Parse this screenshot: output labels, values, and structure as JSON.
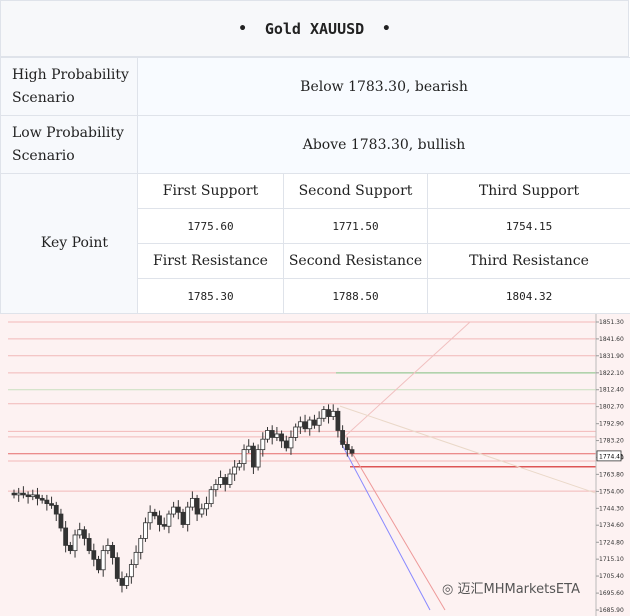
{
  "title": "Gold XAUUSD",
  "title_bullet": "•",
  "scenarios": [
    {
      "label": "High Probability Scenario",
      "value": "Below 1783.30, bearish"
    },
    {
      "label": "Low Probability Scenario",
      "value": "Above 1783.30, bullish"
    }
  ],
  "key_point": {
    "label": "Key Point",
    "support_headers": [
      "First Support",
      "Second Support",
      "Third Support"
    ],
    "support_values": [
      "1775.60",
      "1771.50",
      "1754.15"
    ],
    "resistance_headers": [
      "First Resistance",
      "Second Resistance",
      "Third Resistance"
    ],
    "resistance_values": [
      "1785.30",
      "1788.50",
      "1804.32"
    ]
  },
  "watermark": "迈汇MHMarketsETA",
  "chart_data": {
    "type": "candlestick",
    "y_axis_ticks": [
      "1851.30",
      "1841.60",
      "1831.90",
      "1822.10",
      "1812.40",
      "1802.70",
      "1792.90",
      "1783.20",
      "1773.50",
      "1763.80",
      "1754.00",
      "1744.30",
      "1734.60",
      "1724.80",
      "1715.10",
      "1705.40",
      "1695.60",
      "1685.90"
    ],
    "current_price": "1774.41",
    "close_series": [
      1752,
      1753,
      1752,
      1751,
      1752,
      1750,
      1749,
      1747,
      1746,
      1741,
      1733,
      1723,
      1720,
      1729,
      1732,
      1727,
      1720,
      1715,
      1709,
      1720,
      1723,
      1716,
      1704,
      1700,
      1705,
      1712,
      1719,
      1727,
      1736,
      1742,
      1740,
      1735,
      1734,
      1741,
      1745,
      1742,
      1735,
      1745,
      1750,
      1741,
      1744,
      1747,
      1755,
      1758,
      1762,
      1758,
      1764,
      1768,
      1770,
      1778,
      1780,
      1768,
      1778,
      1784,
      1789,
      1785,
      1787,
      1783,
      1779,
      1785,
      1791,
      1794,
      1790,
      1795,
      1792,
      1796,
      1801,
      1797,
      1800,
      1789,
      1781,
      1778,
      1776
    ],
    "horizontal_levels": [
      1851.3,
      1841.6,
      1831.9,
      1822.1,
      1812.4,
      1804.32,
      1788.5,
      1785.3,
      1775.6,
      1771.5,
      1754.15
    ],
    "colors": {
      "up": "#ffffff",
      "down": "#333333",
      "resistance": "#e88",
      "support": "#e66",
      "green": "#9c9",
      "blue": "#88f"
    }
  }
}
